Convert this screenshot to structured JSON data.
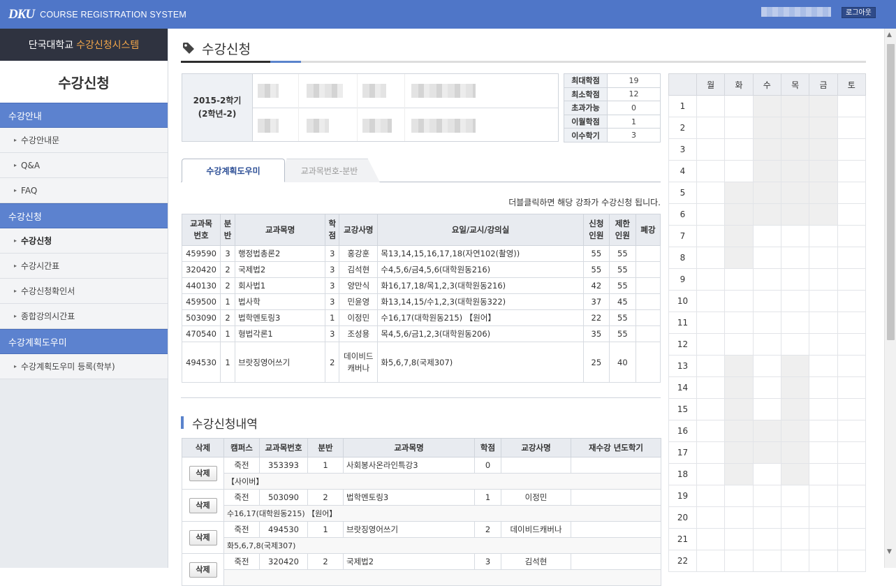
{
  "header": {
    "logo_mark": "DKU",
    "system_name": "COURSE REGISTRATION SYSTEM",
    "logout_label": "로그아웃"
  },
  "sidebar": {
    "title_plain": "단국대학교",
    "title_highlight": "수강신청시스템",
    "heading": "수강신청",
    "sections": [
      {
        "label": "수강안내",
        "items": [
          "수강안내문",
          "Q&A",
          "FAQ"
        ]
      },
      {
        "label": "수강신청",
        "items": [
          "수강신청",
          "수강시간표",
          "수강신청확인서",
          "종합강의시간표"
        ]
      },
      {
        "label": "수강계획도우미",
        "items": [
          "수강계획도우미 등록(학부)"
        ]
      }
    ],
    "active_item": "수강신청"
  },
  "page": {
    "title": "수강신청",
    "semester_line1": "2015-2학기",
    "semester_line2": "(2학년-2)"
  },
  "stats": [
    {
      "label": "최대학점",
      "value": "19"
    },
    {
      "label": "최소학점",
      "value": "12"
    },
    {
      "label": "초과가능",
      "value": "0"
    },
    {
      "label": "이월학점",
      "value": "1"
    },
    {
      "label": "이수학기",
      "value": "3"
    }
  ],
  "tabs": {
    "active": "수강계획도우미",
    "inactive": "교과목번호-분반"
  },
  "hint": "더블클릭하면 해당 강좌가 수강신청 됩니다.",
  "course_table": {
    "headers": [
      "교과목\n번호",
      "분\n반",
      "교과목명",
      "학\n점",
      "교강사명",
      "요일/교시/강의실",
      "신청\n인원",
      "제한\n인원",
      "폐강"
    ],
    "rows": [
      {
        "code": "459590",
        "section": "3",
        "name": "행정법총론2",
        "credit": "3",
        "instructor": "홍강훈",
        "schedule": "목13,14,15,16,17,18(자연102(촬영))",
        "applied": "55",
        "limit": "55",
        "closed": ""
      },
      {
        "code": "320420",
        "section": "2",
        "name": "국제법2",
        "credit": "3",
        "instructor": "김석현",
        "schedule": "수4,5,6/금4,5,6(대학원동216)",
        "applied": "55",
        "limit": "55",
        "closed": ""
      },
      {
        "code": "440130",
        "section": "2",
        "name": "회사법1",
        "credit": "3",
        "instructor": "양만식",
        "schedule": "화16,17,18/목1,2,3(대학원동216)",
        "applied": "42",
        "limit": "55",
        "closed": ""
      },
      {
        "code": "459500",
        "section": "1",
        "name": "법사학",
        "credit": "3",
        "instructor": "민윤영",
        "schedule": "화13,14,15/수1,2,3(대학원동322)",
        "applied": "37",
        "limit": "45",
        "closed": ""
      },
      {
        "code": "503090",
        "section": "2",
        "name": "법학멘토링3",
        "credit": "1",
        "instructor": "이정민",
        "schedule": "수16,17(대학원동215) 【원어】",
        "applied": "22",
        "limit": "55",
        "closed": ""
      },
      {
        "code": "470540",
        "section": "1",
        "name": "형법각론1",
        "credit": "3",
        "instructor": "조성용",
        "schedule": "목4,5,6/금1,2,3(대학원동206)",
        "applied": "35",
        "limit": "55",
        "closed": ""
      },
      {
        "code": "494530",
        "section": "1",
        "name": "브랏징영어쓰기",
        "credit": "2",
        "instructor": "데이비드캐버나",
        "schedule": "화5,6,7,8(국제307)",
        "applied": "25",
        "limit": "40",
        "closed": ""
      }
    ]
  },
  "registration": {
    "heading": "수강신청내역",
    "headers": [
      "삭제",
      "캠퍼스",
      "교과목번호",
      "분반",
      "교과목명",
      "학점",
      "교강사명",
      "재수강 년도학기"
    ],
    "delete_label": "삭제",
    "rows": [
      {
        "campus": "죽전",
        "code": "353393",
        "section": "1",
        "name": "사회봉사온라인특강3",
        "credit": "0",
        "instructor": "",
        "retake": "",
        "note": "【사이버】"
      },
      {
        "campus": "죽전",
        "code": "503090",
        "section": "2",
        "name": "법학멘토링3",
        "credit": "1",
        "instructor": "이정민",
        "retake": "",
        "note": "수16,17(대학원동215) 【원어】"
      },
      {
        "campus": "죽전",
        "code": "494530",
        "section": "1",
        "name": "브랏징영어쓰기",
        "credit": "2",
        "instructor": "데이비드캐버나",
        "retake": "",
        "note": "화5,6,7,8(국제307)"
      },
      {
        "campus": "죽전",
        "code": "320420",
        "section": "2",
        "name": "국제법2",
        "credit": "3",
        "instructor": "김석현",
        "retake": "",
        "note": ""
      }
    ]
  },
  "timetable": {
    "days": [
      "월",
      "화",
      "수",
      "목",
      "금",
      "토"
    ],
    "periods": [
      "1",
      "2",
      "3",
      "4",
      "5",
      "6",
      "7",
      "8",
      "9",
      "10",
      "11",
      "12",
      "13",
      "14",
      "15",
      "16",
      "17",
      "18",
      "19",
      "20",
      "21",
      "22"
    ],
    "shaded": {
      "화": [
        5,
        6,
        7,
        8,
        13,
        14,
        15,
        16,
        17,
        18
      ],
      "수": [
        1,
        2,
        3,
        4,
        5,
        6,
        16,
        17
      ],
      "목": [
        1,
        2,
        3,
        4,
        5,
        6,
        13,
        14,
        15,
        16,
        17,
        18
      ],
      "금": [
        1,
        2,
        3,
        4,
        5,
        6
      ]
    },
    "shade_color": "#efefef"
  },
  "colors": {
    "header_bg": "#4f76c8",
    "section_bg": "#5c82cf",
    "accent": "#f2a64a"
  }
}
